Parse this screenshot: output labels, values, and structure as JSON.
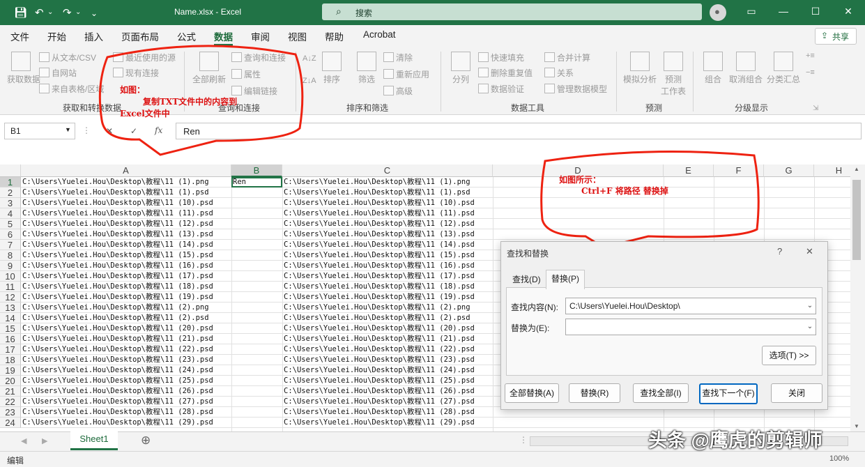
{
  "titlebar": {
    "filename": "Name.xlsx",
    "sep": " - ",
    "app": "Excel",
    "search_label": "搜索",
    "user_icon": "user-icon",
    "accent": "#217346"
  },
  "menu": {
    "tabs": [
      "文件",
      "开始",
      "插入",
      "页面布局",
      "公式",
      "数据",
      "审阅",
      "视图",
      "帮助",
      "Acrobat"
    ],
    "active": "数据",
    "share": "共享"
  },
  "ribbon": {
    "get_data": "获取数据",
    "from_text": "从文本/CSV",
    "from_web": "自网站",
    "from_table": "来自表格/区域",
    "recent": "最近使用的源",
    "existing": "现有连接",
    "group1": "获取和转换数据",
    "refresh_all": "全部刷新",
    "queries": "查询和连接",
    "properties": "属性",
    "edit_links": "编辑链接",
    "group2": "查询和连接",
    "sort": "排序",
    "filter": "筛选",
    "clear": "清除",
    "reapply": "重新应用",
    "advanced": "高级",
    "group3": "排序和筛选",
    "split": "分列",
    "flash_fill": "快速填充",
    "remove_dup": "删除重复值",
    "validation": "数据验证",
    "consolidate": "合并计算",
    "relations": "关系",
    "manage_model": "管理数据模型",
    "group4": "数据工具",
    "whatif": "模拟分析",
    "forecast": "预测",
    "forecast_sheet": "工作表",
    "group5": "预测",
    "group_btn": "组合",
    "ungroup": "取消组合",
    "subtotal": "分类汇总",
    "group6": "分级显示"
  },
  "formula_bar": {
    "name_box": "B1",
    "cancel": "✕",
    "confirm": "✓",
    "fx": "fx",
    "content": "Ren"
  },
  "grid": {
    "columns": [
      "A",
      "B",
      "C",
      "D",
      "E",
      "F",
      "G",
      "H"
    ],
    "selected_column": "B",
    "b1": "Ren",
    "rows": [
      {
        "n": "1",
        "a": "C:\\Users\\Yuelei.Hou\\Desktop\\教程\\11 (1).png",
        "c": "C:\\Users\\Yuelei.Hou\\Desktop\\教程\\11 (1).png"
      },
      {
        "n": "2",
        "a": "C:\\Users\\Yuelei.Hou\\Desktop\\教程\\11 (1).psd",
        "c": "C:\\Users\\Yuelei.Hou\\Desktop\\教程\\11 (1).psd"
      },
      {
        "n": "3",
        "a": "C:\\Users\\Yuelei.Hou\\Desktop\\教程\\11 (10).psd",
        "c": "C:\\Users\\Yuelei.Hou\\Desktop\\教程\\11 (10).psd"
      },
      {
        "n": "4",
        "a": "C:\\Users\\Yuelei.Hou\\Desktop\\教程\\11 (11).psd",
        "c": "C:\\Users\\Yuelei.Hou\\Desktop\\教程\\11 (11).psd"
      },
      {
        "n": "5",
        "a": "C:\\Users\\Yuelei.Hou\\Desktop\\教程\\11 (12).psd",
        "c": "C:\\Users\\Yuelei.Hou\\Desktop\\教程\\11 (12).psd"
      },
      {
        "n": "6",
        "a": "C:\\Users\\Yuelei.Hou\\Desktop\\教程\\11 (13).psd",
        "c": "C:\\Users\\Yuelei.Hou\\Desktop\\教程\\11 (13).psd"
      },
      {
        "n": "7",
        "a": "C:\\Users\\Yuelei.Hou\\Desktop\\教程\\11 (14).psd",
        "c": "C:\\Users\\Yuelei.Hou\\Desktop\\教程\\11 (14).psd"
      },
      {
        "n": "8",
        "a": "C:\\Users\\Yuelei.Hou\\Desktop\\教程\\11 (15).psd",
        "c": "C:\\Users\\Yuelei.Hou\\Desktop\\教程\\11 (15).psd"
      },
      {
        "n": "9",
        "a": "C:\\Users\\Yuelei.Hou\\Desktop\\教程\\11 (16).psd",
        "c": "C:\\Users\\Yuelei.Hou\\Desktop\\教程\\11 (16).psd"
      },
      {
        "n": "10",
        "a": "C:\\Users\\Yuelei.Hou\\Desktop\\教程\\11 (17).psd",
        "c": "C:\\Users\\Yuelei.Hou\\Desktop\\教程\\11 (17).psd"
      },
      {
        "n": "11",
        "a": "C:\\Users\\Yuelei.Hou\\Desktop\\教程\\11 (18).psd",
        "c": "C:\\Users\\Yuelei.Hou\\Desktop\\教程\\11 (18).psd"
      },
      {
        "n": "12",
        "a": "C:\\Users\\Yuelei.Hou\\Desktop\\教程\\11 (19).psd",
        "c": "C:\\Users\\Yuelei.Hou\\Desktop\\教程\\11 (19).psd"
      },
      {
        "n": "13",
        "a": "C:\\Users\\Yuelei.Hou\\Desktop\\教程\\11 (2).png",
        "c": "C:\\Users\\Yuelei.Hou\\Desktop\\教程\\11 (2).png"
      },
      {
        "n": "14",
        "a": "C:\\Users\\Yuelei.Hou\\Desktop\\教程\\11 (2).psd",
        "c": "C:\\Users\\Yuelei.Hou\\Desktop\\教程\\11 (2).psd"
      },
      {
        "n": "15",
        "a": "C:\\Users\\Yuelei.Hou\\Desktop\\教程\\11 (20).psd",
        "c": "C:\\Users\\Yuelei.Hou\\Desktop\\教程\\11 (20).psd"
      },
      {
        "n": "16",
        "a": "C:\\Users\\Yuelei.Hou\\Desktop\\教程\\11 (21).psd",
        "c": "C:\\Users\\Yuelei.Hou\\Desktop\\教程\\11 (21).psd"
      },
      {
        "n": "17",
        "a": "C:\\Users\\Yuelei.Hou\\Desktop\\教程\\11 (22).psd",
        "c": "C:\\Users\\Yuelei.Hou\\Desktop\\教程\\11 (22).psd"
      },
      {
        "n": "18",
        "a": "C:\\Users\\Yuelei.Hou\\Desktop\\教程\\11 (23).psd",
        "c": "C:\\Users\\Yuelei.Hou\\Desktop\\教程\\11 (23).psd"
      },
      {
        "n": "19",
        "a": "C:\\Users\\Yuelei.Hou\\Desktop\\教程\\11 (24).psd",
        "c": "C:\\Users\\Yuelei.Hou\\Desktop\\教程\\11 (24).psd"
      },
      {
        "n": "20",
        "a": "C:\\Users\\Yuelei.Hou\\Desktop\\教程\\11 (25).psd",
        "c": "C:\\Users\\Yuelei.Hou\\Desktop\\教程\\11 (25).psd"
      },
      {
        "n": "21",
        "a": "C:\\Users\\Yuelei.Hou\\Desktop\\教程\\11 (26).psd",
        "c": "C:\\Users\\Yuelei.Hou\\Desktop\\教程\\11 (26).psd"
      },
      {
        "n": "22",
        "a": "C:\\Users\\Yuelei.Hou\\Desktop\\教程\\11 (27).psd",
        "c": "C:\\Users\\Yuelei.Hou\\Desktop\\教程\\11 (27).psd"
      },
      {
        "n": "23",
        "a": "C:\\Users\\Yuelei.Hou\\Desktop\\教程\\11 (28).psd",
        "c": "C:\\Users\\Yuelei.Hou\\Desktop\\教程\\11 (28).psd"
      },
      {
        "n": "24",
        "a": "C:\\Users\\Yuelei.Hou\\Desktop\\教程\\11 (29).psd",
        "c": "C:\\Users\\Yuelei.Hou\\Desktop\\教程\\11 (29).psd"
      }
    ]
  },
  "annotations": {
    "top_title": "如图：",
    "top_line1": "复制TXT文件中的内容到",
    "top_line2": "Excel文件中",
    "right_title": "如图所示：",
    "right_line1": "Ctrl+F 将路径 替换掉",
    "color": "#dd1111"
  },
  "dialog": {
    "title": "查找和替换",
    "help": "?",
    "close_x": "✕",
    "tab_find": "查找(D)",
    "tab_replace": "替换(P)",
    "find_label": "查找内容(N):",
    "find_value": "C:\\Users\\Yuelei.Hou\\Desktop\\",
    "replace_label": "替换为(E):",
    "replace_value": "",
    "options": "选项(T) >>",
    "replace_all": "全部替换(A)",
    "replace": "替换(R)",
    "find_all": "查找全部(I)",
    "find_next": "查找下一个(F)",
    "close": "关闭"
  },
  "sheets": {
    "tabs": [
      "Sheet1"
    ],
    "add": "⊕"
  },
  "status": {
    "mode": "编辑",
    "zoom": "100%"
  },
  "watermark": "头条 @鹰虎的剪辑师"
}
